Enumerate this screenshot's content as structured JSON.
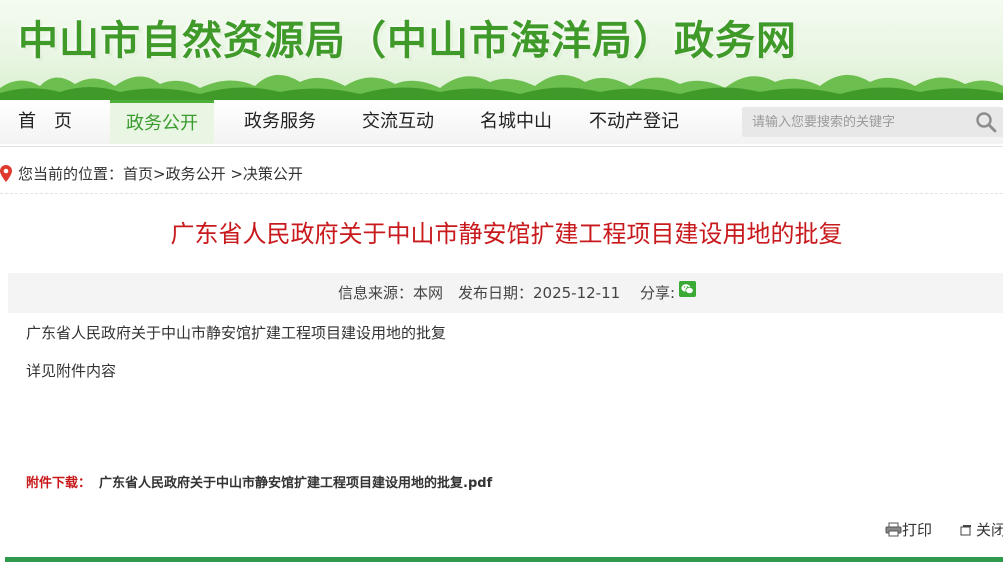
{
  "header": {
    "site_title": "中山市自然资源局（中山市海洋局）政务网"
  },
  "nav": {
    "items": [
      {
        "label": "首　页"
      },
      {
        "label": "政务公开",
        "active": true
      },
      {
        "label": "政务服务"
      },
      {
        "label": "交流互动"
      },
      {
        "label": "名城中山"
      },
      {
        "label": "不动产登记"
      }
    ]
  },
  "search": {
    "placeholder": "请输入您要搜索的关键字",
    "icon": "search-icon"
  },
  "breadcrumb": {
    "text": "您当前的位置：首页>政务公开 >决策公开",
    "icon": "location-pin-icon"
  },
  "article": {
    "title": "广东省人民政府关于中山市静安馆扩建工程项目建设用地的批复",
    "meta": "信息来源：本网　发布日期：2025-12-11　 分享:",
    "share_icon": "wechat-icon",
    "paragraphs": [
      "广东省人民政府关于中山市静安馆扩建工程项目建设用地的批复",
      "详见附件内容"
    ],
    "attachment_label": "附件下载：",
    "attachment_name": "广东省人民政府关于中山市静安馆扩建工程项目建设用地的批复.pdf"
  },
  "tools": {
    "print_label": "打印",
    "close_label": "关闭"
  },
  "colors": {
    "brand_green": "#3f9a2a",
    "title_red": "#c8191c",
    "footer_green": "#2f9a4e"
  }
}
